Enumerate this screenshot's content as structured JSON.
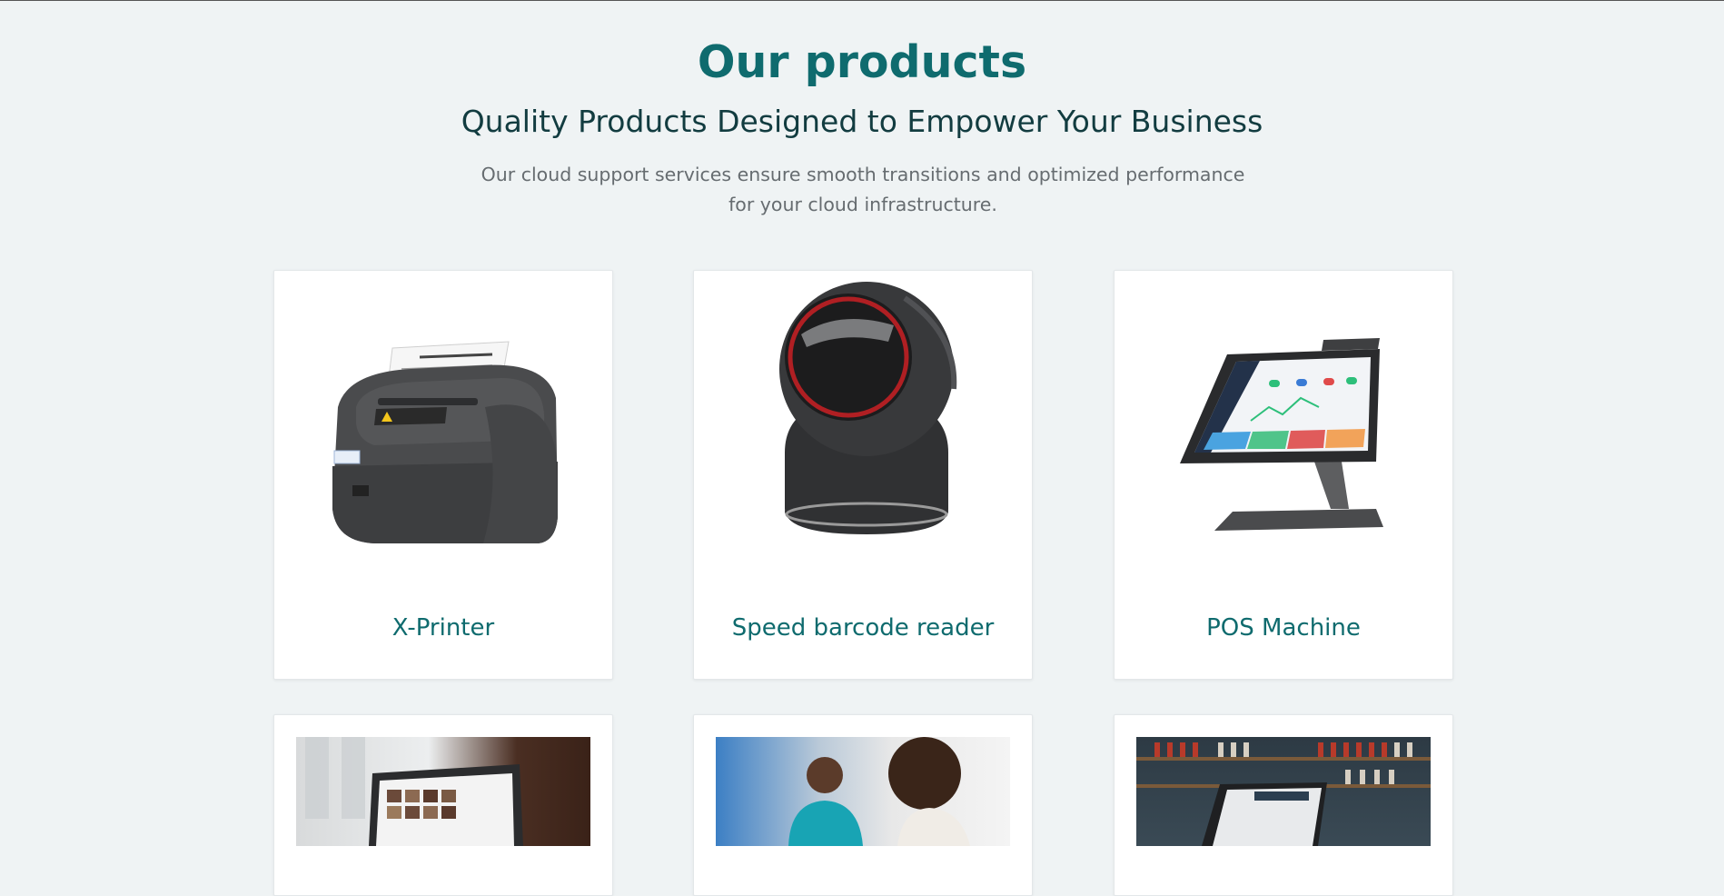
{
  "header": {
    "title": "Our products",
    "subtitle": "Quality Products Designed to Empower Your Business",
    "description": "Our cloud support services ensure smooth transitions and optimized performance for your cloud infrastructure."
  },
  "products": [
    {
      "name": "X-Printer",
      "icon": "thermal-printer-image"
    },
    {
      "name": "Speed barcode reader",
      "icon": "barcode-scanner-image"
    },
    {
      "name": "POS Machine",
      "icon": "pos-terminal-image"
    }
  ],
  "photo_cards": [
    {
      "icon": "tablet-menu-photo"
    },
    {
      "icon": "people-shopping-photo"
    },
    {
      "icon": "bar-pos-photo"
    }
  ],
  "colors": {
    "accent": "#0f6b6e",
    "background": "#eff3f4",
    "card": "#ffffff"
  }
}
